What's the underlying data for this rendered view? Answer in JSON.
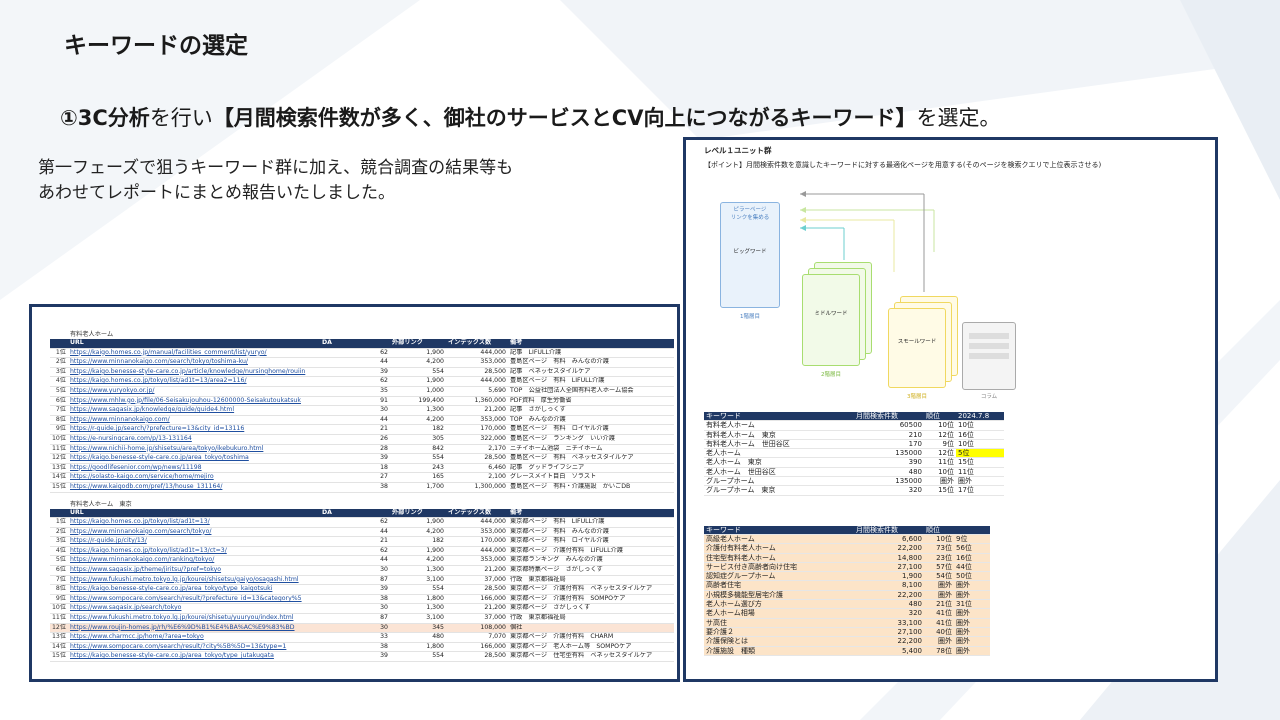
{
  "header": {
    "title": "キーワードの選定",
    "subtitle_lead": "①3C分析",
    "subtitle_mid": "を行い",
    "subtitle_bold": "【月間検索件数が多く、御社のサービスとCV向上につながるキーワード】",
    "subtitle_tail": "を選定。"
  },
  "note": {
    "line1": "第一フェーズで狙うキーワード群に加え、競合調査の結果等も",
    "line2": "あわせてレポートにまとめ報告いたしました。"
  },
  "left_sheet": {
    "table1_caption": "有料老人ホーム",
    "table2_caption": "有料老人ホーム　東京",
    "columns": [
      "",
      "URL",
      "DA",
      "外部リンク",
      "インデックス数",
      "備考"
    ],
    "table1_rows": [
      [
        "1位",
        "https://kaigo.homes.co.jp/manual/facilities_comment/list/yuryo/",
        "62",
        "1,900",
        "444,000",
        "記事　LIFULL介護"
      ],
      [
        "2位",
        "https://www.minnanokaigo.com/search/tokyo/toshima-ku/",
        "44",
        "4,200",
        "353,000",
        "豊島区ページ　有料　みんなの介護"
      ],
      [
        "3位",
        "https://kaigo.benesse-style-care.co.jp/article/knowledge/nursinghome/rouiin",
        "39",
        "554",
        "28,500",
        "記事　ベネッセスタイルケア"
      ],
      [
        "4位",
        "https://kaigo.homes.co.jp/tokyo/list/ad1t=13/area2=116/",
        "62",
        "1,900",
        "444,000",
        "豊島区ページ　有料　LIFULL介護"
      ],
      [
        "5位",
        "https://www.yuryokyo.or.jp/",
        "35",
        "1,000",
        "5,690",
        "TOP　公益社団法人全国有料老人ホーム協会"
      ],
      [
        "6位",
        "https://www.mhlw.go.jp/file/06-Seisakujouhou-12600000-Seisakutoukatsuk",
        "91",
        "199,400",
        "1,360,000",
        "PDF資料　厚生労働省"
      ],
      [
        "7位",
        "https://www.sagasix.jp/knowledge/guide/guide4.html",
        "30",
        "1,300",
        "21,200",
        "記事　さがしっくす"
      ],
      [
        "8位",
        "https://www.minnanokaigo.com/",
        "44",
        "4,200",
        "353,000",
        "TOP　みんなの介護"
      ],
      [
        "9位",
        "https://r-guide.jp/search/?prefecture=13&city_id=13116",
        "21",
        "182",
        "170,000",
        "豊島区ページ　有料　ロイヤル介護"
      ],
      [
        "10位",
        "https://e-nursingcare.com/p/13-131164",
        "26",
        "305",
        "322,000",
        "豊島区ページ　ランキング　いい介護"
      ],
      [
        "11位",
        "https://www.nichii-home.jp/shisetsu/area/tokyo/ikebukuro.html",
        "28",
        "842",
        "2,170",
        "ニチイホーム池袋　ニチイホーム"
      ],
      [
        "12位",
        "https://kaigo.benesse-style-care.co.jp/area_tokyo/toshima",
        "39",
        "554",
        "28,500",
        "豊島区ページ　有料　ベネッセスタイルケア"
      ],
      [
        "13位",
        "https://goodlifesenior.com/wp/news/11198",
        "18",
        "243",
        "6,460",
        "記事　グッドライフシニア"
      ],
      [
        "14位",
        "https://solasto-kaigo.com/service/home/mejiro",
        "27",
        "165",
        "2,100",
        "グレースメイト目白　ソラスト"
      ],
      [
        "15位",
        "https://www.kaigodb.com/pref/13/house_131164/",
        "38",
        "1,700",
        "1,300,000",
        "豊島区ページ　有料・介護施設　かいごDB"
      ]
    ],
    "table2_rows": [
      [
        "1位",
        "https://kaigo.homes.co.jp/tokyo/list/ad1t=13/",
        "62",
        "1,900",
        "444,000",
        "東京都ページ　有料　LIFULL介護"
      ],
      [
        "2位",
        "https://www.minnanokaigo.com/search/tokyo/",
        "44",
        "4,200",
        "353,000",
        "東京都ページ　有料　みんなの介護"
      ],
      [
        "3位",
        "https://r-guide.jp/city/13/",
        "21",
        "182",
        "170,000",
        "東京都ページ　有料　ロイヤル介護"
      ],
      [
        "4位",
        "https://kaigo.homes.co.jp/tokyo/list/ad1t=13/ct=3/",
        "62",
        "1,900",
        "444,000",
        "東京都ページ　介護付有料　LIFULL介護"
      ],
      [
        "5位",
        "https://www.minnanokaigo.com/ranking/tokyo/",
        "44",
        "4,200",
        "353,000",
        "東京都ランキング　みんなの介護"
      ],
      [
        "6位",
        "https://www.sagasix.jp/theme/jiritsu/?pref=tokyo",
        "30",
        "1,300",
        "21,200",
        "東京都特集ページ　さがしっくす"
      ],
      [
        "7位",
        "https://www.fukushi.metro.tokyo.lg.jp/kourei/shisetsu/gaiyo/osagashi.html",
        "87",
        "3,100",
        "37,000",
        "行政　東京都福祉局"
      ],
      [
        "8位",
        "https://kaigo.benesse-style-care.co.jp/area_tokyo/type_kaigotsuki",
        "39",
        "554",
        "28,500",
        "東京都ページ　介護付有料　ベネッセスタイルケア"
      ],
      [
        "9位",
        "https://www.sompocare.com/search/result/?prefecture_id=13&category%5",
        "38",
        "1,800",
        "166,000",
        "東京都ページ　介護付有料　SOMPOケア"
      ],
      [
        "10位",
        "https://www.sagasix.jp/search/tokyo",
        "30",
        "1,300",
        "21,200",
        "東京都ページ　さがしっくす"
      ],
      [
        "11位",
        "https://www.fukushi.metro.tokyo.lg.jp/kourei/shisetu/yuuryou/index.html",
        "87",
        "3,100",
        "37,000",
        "行政　東京都福祉局"
      ],
      [
        "12位",
        "https://www.roujin-homes.jp/rh/%E6%9D%B1%E4%BA%AC%E9%83%BD",
        "30",
        "345",
        "108,000",
        "個社"
      ],
      [
        "13位",
        "https://www.charmcc.jp/home/?area=tokyo",
        "33",
        "480",
        "7,070",
        "東京都ページ　介護付有料　CHARM"
      ],
      [
        "14位",
        "https://www.sompocare.com/search/result/?city%5B%5D=13&type=1",
        "38",
        "1,800",
        "166,000",
        "東京都ページ　老人ホーム等　SOMPOケア"
      ],
      [
        "15位",
        "https://kaigo.benesse-style-care.co.jp/area_tokyo/type_jutakugata",
        "39",
        "554",
        "28,500",
        "東京都ページ　住宅型有料　ベネッセスタイルケア"
      ]
    ]
  },
  "right_sheet": {
    "title": "レベル１ユニット群",
    "point": "【ポイント】月間検索件数を意識したキーワードに対する最適化ページを用意する(そのページを検索クエリで上位表示させる)",
    "diagram": {
      "pillar_top": "ピラーページ",
      "pillar_top2": "リンクを集める",
      "big_word": "ビッグワード",
      "big_caption": "1階層目",
      "middle_word": "ミドルワード",
      "middle_caption": "2階層目",
      "small_word": "スモールワード",
      "small_caption": "3階層目",
      "column_caption": "コラム",
      "column_caption2": "(テーマごとに仕分)"
    },
    "kw1_headers": [
      "キーワード",
      "月間検索件数",
      "順位",
      "2024.7.8"
    ],
    "kw1_rows": [
      [
        "有料老人ホーム",
        "60500",
        "10位",
        "10位"
      ],
      [
        "有料老人ホーム　東京",
        "210",
        "12位",
        "16位"
      ],
      [
        "有料老人ホーム　世田谷区",
        "170",
        "9位",
        "10位"
      ],
      [
        "老人ホーム",
        "135000",
        "12位",
        "5位"
      ],
      [
        "老人ホーム　東京",
        "390",
        "11位",
        "15位"
      ],
      [
        "老人ホーム　世田谷区",
        "480",
        "10位",
        "11位"
      ],
      [
        "グループホーム",
        "135000",
        "圏外",
        "圏外"
      ],
      [
        "グループホーム　東京",
        "320",
        "15位",
        "17位"
      ]
    ],
    "kw2_headers": [
      "キーワード",
      "月間検索件数",
      "順位",
      ""
    ],
    "kw2_rows": [
      [
        "高級老人ホーム",
        "6,600",
        "10位",
        "9位"
      ],
      [
        "介護付有料老人ホーム",
        "22,200",
        "73位",
        "56位"
      ],
      [
        "住宅型有料老人ホーム",
        "14,800",
        "23位",
        "16位"
      ],
      [
        "サービス付き高齢者向け住宅",
        "27,100",
        "57位",
        "44位"
      ],
      [
        "認知症グループホーム",
        "1,900",
        "54位",
        "50位"
      ],
      [
        "高齢者住宅",
        "8,100",
        "圏外",
        "圏外"
      ],
      [
        "小規模多機能型居宅介護",
        "22,200",
        "圏外",
        "圏外"
      ],
      [
        "老人ホーム選び方",
        "480",
        "21位",
        "31位"
      ],
      [
        "老人ホーム相場",
        "320",
        "41位",
        "圏外"
      ],
      [
        "サ高住",
        "33,100",
        "41位",
        "圏外"
      ],
      [
        "要介護２",
        "27,100",
        "40位",
        "圏外"
      ],
      [
        "介護保険とは",
        "22,200",
        "圏外",
        "圏外"
      ],
      [
        "介護施設　種類",
        "5,400",
        "78位",
        "圏外"
      ]
    ]
  },
  "colors": {
    "navy": "#1f3864",
    "highlight_yellow": "#ffff00",
    "highlight_peach": "#fce4c8"
  }
}
